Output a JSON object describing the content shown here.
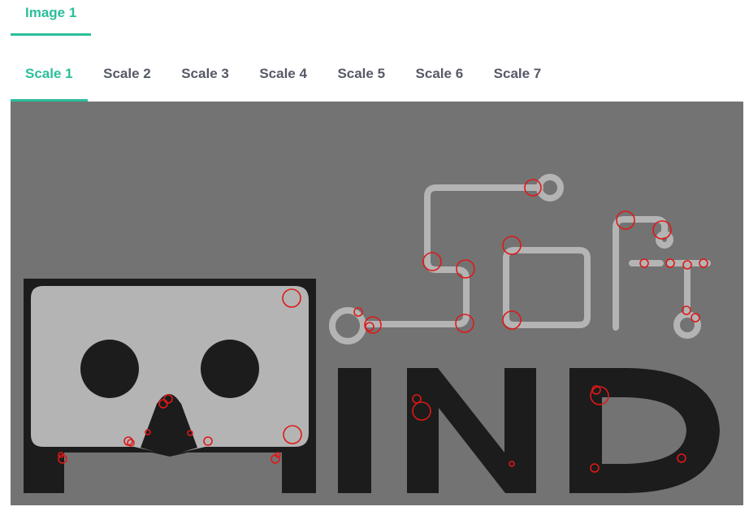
{
  "image_tabs": [
    {
      "label": "Image 1",
      "active": true
    }
  ],
  "scale_tabs": [
    {
      "label": "Scale 1",
      "active": true
    },
    {
      "label": "Scale 2",
      "active": false
    },
    {
      "label": "Scale 3",
      "active": false
    },
    {
      "label": "Scale 4",
      "active": false
    },
    {
      "label": "Scale 5",
      "active": false
    },
    {
      "label": "Scale 6",
      "active": false
    },
    {
      "label": "Scale 7",
      "active": false
    }
  ],
  "colors": {
    "accent": "#2bbf9a",
    "inactive_tab_text": "#555a66",
    "image_background": "#737373",
    "logo_dark": "#1c1c1c",
    "logo_light": "#b4b4b4",
    "keypoint_circle": "#e01818"
  },
  "image": {
    "logo_text": "MIND",
    "logo_subtext": "Soft"
  }
}
